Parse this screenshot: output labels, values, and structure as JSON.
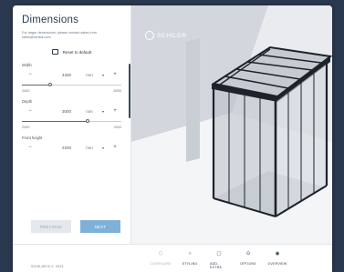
{
  "panel": {
    "title": "Dimensions",
    "hint": "For larger dimensions, please contact sales from sales@schildr.com",
    "reset_label": "Reset to default",
    "fields": [
      {
        "label": "Width",
        "value": "4300",
        "unit": "mm",
        "min": "2400",
        "max": "8300",
        "fill": 0.28
      },
      {
        "label": "Depth",
        "value": "3000",
        "unit": "mm",
        "min": "2400",
        "max": "3300",
        "fill": 0.66
      },
      {
        "label": "Front height",
        "value": "2200",
        "unit": "mm"
      }
    ],
    "previous_label": "PREVIOUS",
    "next_label": "NEXT"
  },
  "viewer": {
    "brand": "SCHILDR"
  },
  "footer": {
    "copyright": "SCHILDR B.V. 2023",
    "steps": [
      {
        "label": "CONFIGURE",
        "icon": "cube-icon",
        "active": true
      },
      {
        "label": "STYLING",
        "icon": "circle-icon",
        "active": false
      },
      {
        "label": "ADD-EXTRA",
        "icon": "box-icon",
        "active": false
      },
      {
        "label": "OPTIONS",
        "icon": "options-icon",
        "active": false
      },
      {
        "label": "OVERVIEW",
        "icon": "eye-icon",
        "active": false
      }
    ]
  },
  "colors": {
    "accent": "#7fb1d8",
    "frame": "#2b3950",
    "text": "#2c3a4d"
  }
}
